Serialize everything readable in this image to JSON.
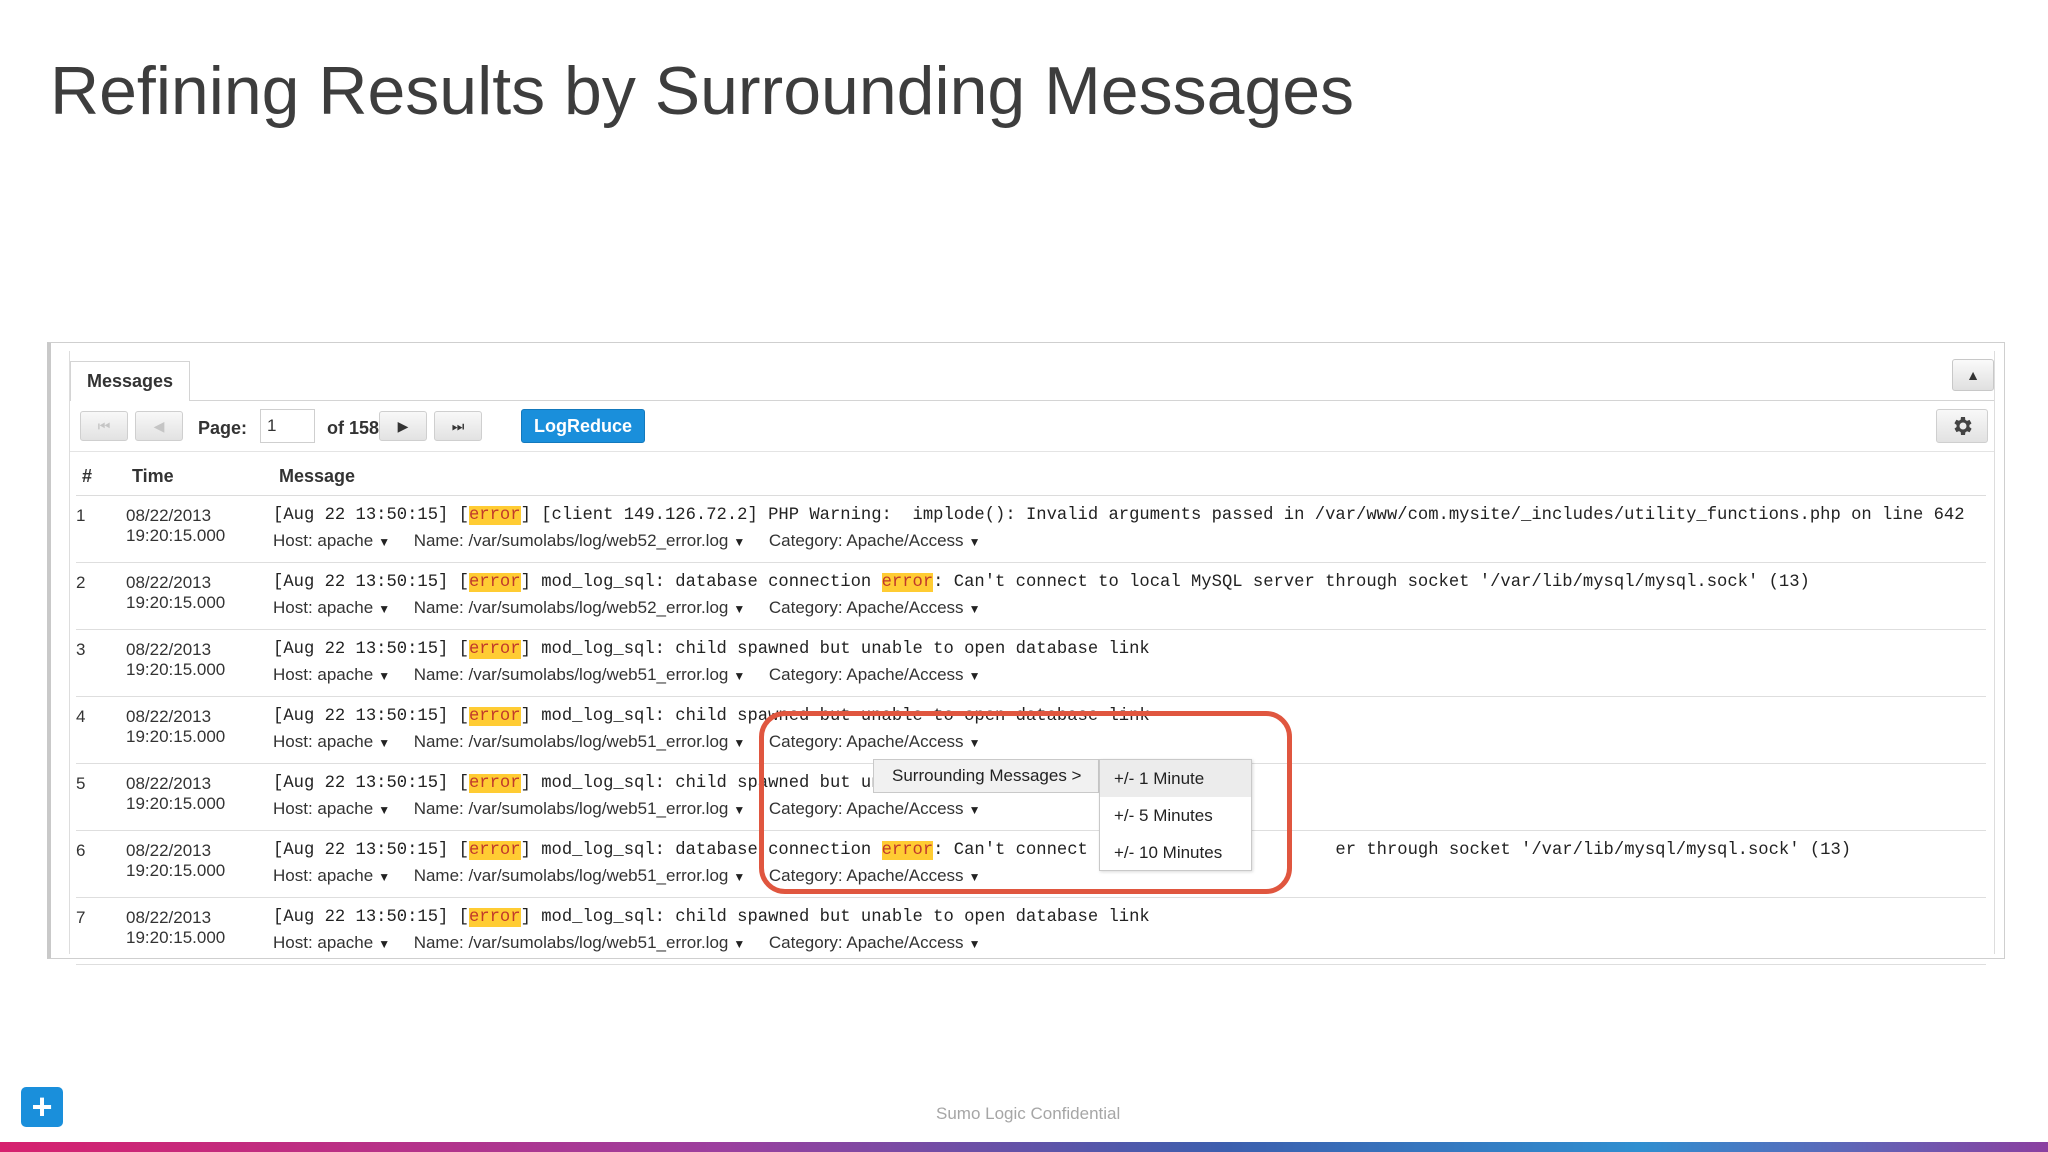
{
  "slide": {
    "title": "Refining Results by Surrounding Messages",
    "footer": "Sumo Logic Confidential"
  },
  "panel": {
    "tab_label": "Messages",
    "page_label": "Page:",
    "page_value": "1",
    "of_label": "of 158",
    "logreduce_label": "LogReduce",
    "columns": [
      "#",
      "Time",
      "Message"
    ]
  },
  "rows": [
    {
      "num": "1",
      "date": "08/22/2013",
      "time": "19:20:15.000",
      "pre": "[Aug 22 13:50:15] [",
      "hl": "error",
      "post": "] [client 149.126.72.2] PHP Warning:  implode(): Invalid arguments passed in /var/www/com.mysite/_includes/utility_functions.php on line 642",
      "hl2": "",
      "post2": "",
      "host": "Host: apache",
      "name": "Name: /var/sumolabs/log/web52_error.log",
      "category": "Category: Apache/Access"
    },
    {
      "num": "2",
      "date": "08/22/2013",
      "time": "19:20:15.000",
      "pre": "[Aug 22 13:50:15] [",
      "hl": "error",
      "post": "] mod_log_sql: database connection ",
      "hl2": "error",
      "post2": ": Can't connect to local MySQL server through socket '/var/lib/mysql/mysql.sock' (13)",
      "host": "Host: apache",
      "name": "Name: /var/sumolabs/log/web52_error.log",
      "category": "Category: Apache/Access"
    },
    {
      "num": "3",
      "date": "08/22/2013",
      "time": "19:20:15.000",
      "pre": "[Aug 22 13:50:15] [",
      "hl": "error",
      "post": "] mod_log_sql: child spawned but unable to open database link",
      "hl2": "",
      "post2": "",
      "host": "Host: apache",
      "name": "Name: /var/sumolabs/log/web51_error.log",
      "category": "Category: Apache/Access"
    },
    {
      "num": "4",
      "date": "08/22/2013",
      "time": "19:20:15.000",
      "pre": "[Aug 22 13:50:15] [",
      "hl": "error",
      "post": "] mod_log_sql: child spawned but unable to open database link",
      "hl2": "",
      "post2": "",
      "host": "Host: apache",
      "name": "Name: /var/sumolabs/log/web51_error.log",
      "category": "Category: Apache/Access"
    },
    {
      "num": "5",
      "date": "08/22/2013",
      "time": "19:20:15.000",
      "pre": "[Aug 22 13:50:15] [",
      "hl": "error",
      "post": "] mod_log_sql: child spawned but unab",
      "hl2": "",
      "post2": "",
      "host": "Host: apache",
      "name": "Name: /var/sumolabs/log/web51_error.log",
      "category": "Category: Apache/Access"
    },
    {
      "num": "6",
      "date": "08/22/2013",
      "time": "19:20:15.000",
      "pre": "[Aug 22 13:50:15] [",
      "hl": "error",
      "post": "] mod_log_sql: database connection ",
      "hl2": "error",
      "post2": ": Can't connect to                     er through socket '/var/lib/mysql/mysql.sock' (13)",
      "host": "Host: apache",
      "name": "Name: /var/sumolabs/log/web51_error.log",
      "category": "Category: Apache/Access"
    },
    {
      "num": "7",
      "date": "08/22/2013",
      "time": "19:20:15.000",
      "pre": "[Aug 22 13:50:15] [",
      "hl": "error",
      "post": "] mod_log_sql: child spawned but unable to open database link",
      "hl2": "",
      "post2": "",
      "host": "Host: apache",
      "name": "Name: /var/sumolabs/log/web51_error.log",
      "category": "Category: Apache/Access"
    }
  ],
  "context_menu": {
    "main_item": "Surrounding Messages  >",
    "submenu": [
      "+/- 1 Minute",
      "+/- 5 Minutes",
      "+/- 10 Minutes"
    ]
  },
  "colors": {
    "accent": "#1a8fdb",
    "highlight": "#ffcc33",
    "callout": "#e0563f"
  }
}
